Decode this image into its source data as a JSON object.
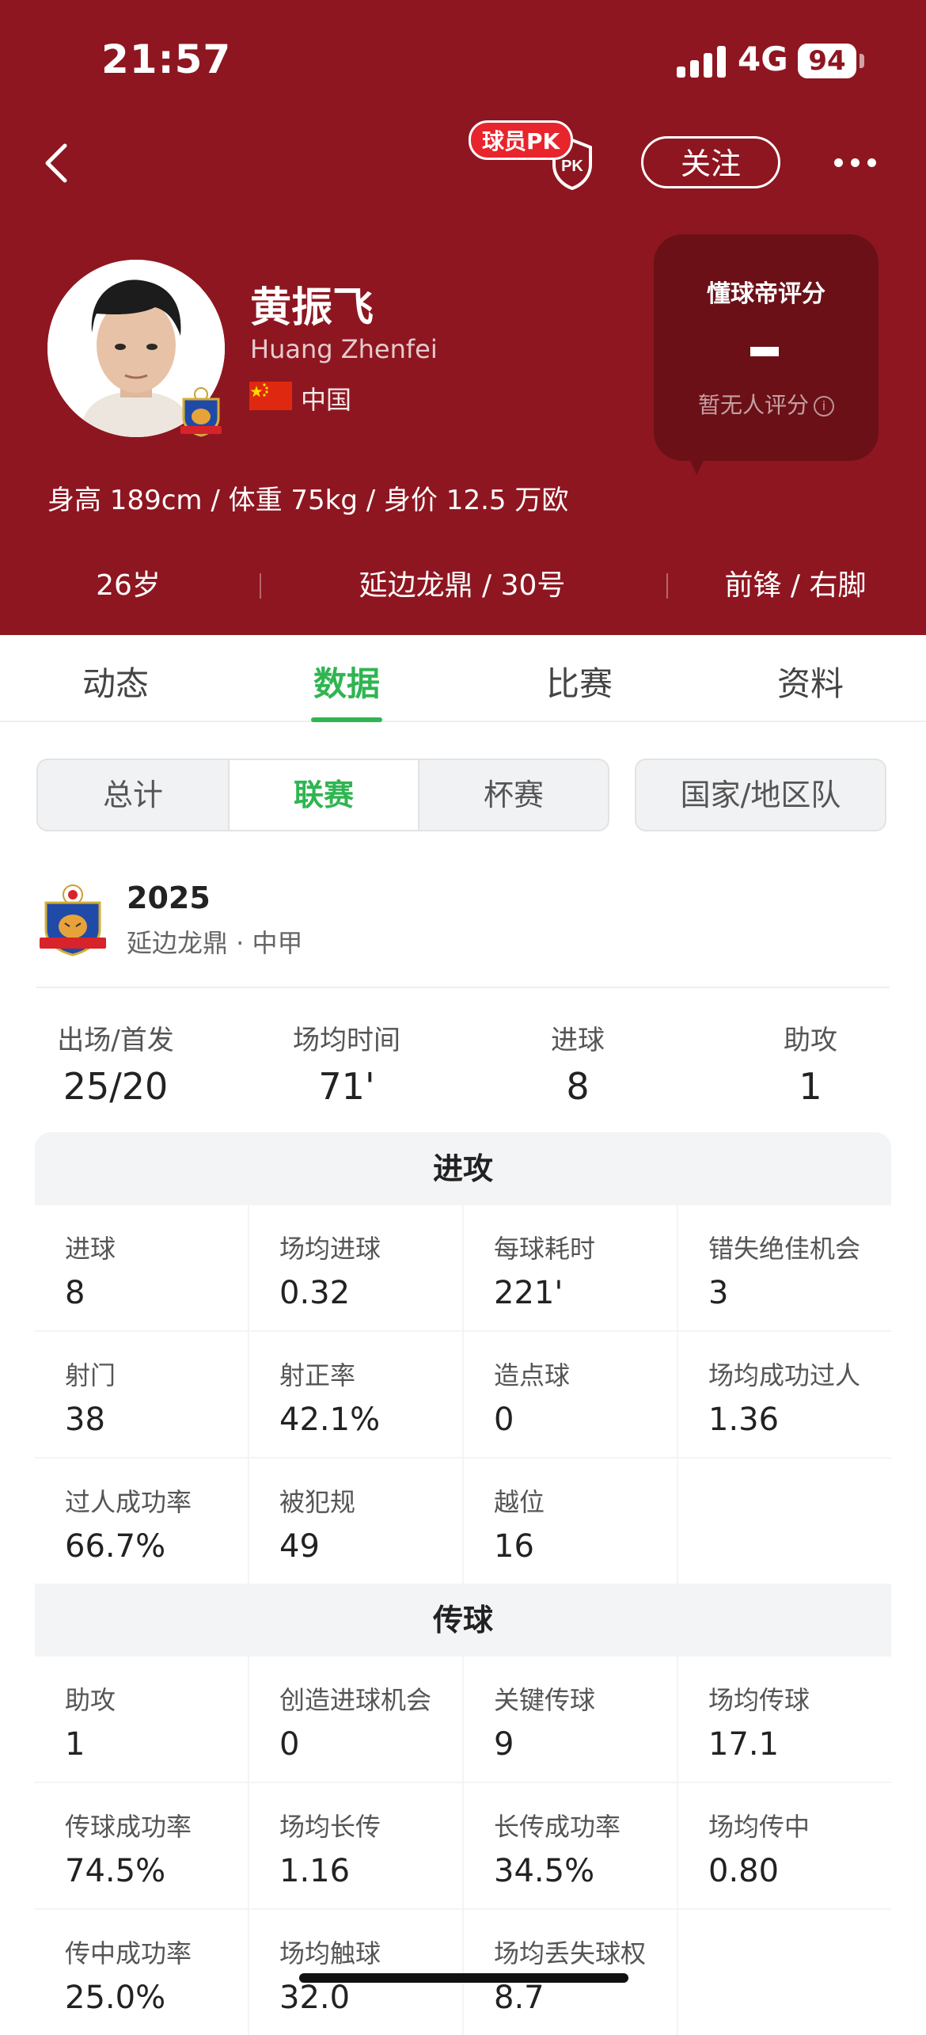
{
  "status_bar": {
    "time": "21:57",
    "network": "4G",
    "battery": "94"
  },
  "header": {
    "pk_label": "球员PK",
    "pk_shield_text": "PK",
    "follow_label": "关注",
    "player_name": "黄振飞",
    "player_name_en": "Huang Zhenfei",
    "country": "中国",
    "body_info": "身高 189cm / 体重 75kg / 身价 12.5 万欧",
    "rating": {
      "title": "懂球帝评分",
      "value": "-",
      "subtitle": "暂无人评分"
    },
    "meta": {
      "age": "26岁",
      "club_number": "延边龙鼎 / 30号",
      "position_foot": "前锋 / 右脚"
    },
    "colors": {
      "header_bg": "#8e1620",
      "rating_bg": "#6b1017",
      "accent_green": "#2fb551"
    }
  },
  "tabs": [
    {
      "label": "动态",
      "active": false
    },
    {
      "label": "数据",
      "active": true
    },
    {
      "label": "比赛",
      "active": false
    },
    {
      "label": "资料",
      "active": false
    }
  ],
  "segment": {
    "items": [
      {
        "label": "总计",
        "active": false
      },
      {
        "label": "联赛",
        "active": true
      },
      {
        "label": "杯赛",
        "active": false
      }
    ],
    "national_label": "国家/地区队"
  },
  "season": {
    "year": "2025",
    "league": "延边龙鼎 · 中甲",
    "summary": [
      {
        "label": "出场/首发",
        "value": "25/20"
      },
      {
        "label": "场均时间",
        "value": "71'"
      },
      {
        "label": "进球",
        "value": "8"
      },
      {
        "label": "助攻",
        "value": "1"
      }
    ]
  },
  "sections": [
    {
      "title": "进攻",
      "stats": [
        {
          "label": "进球",
          "value": "8"
        },
        {
          "label": "场均进球",
          "value": "0.32"
        },
        {
          "label": "每球耗时",
          "value": "221'"
        },
        {
          "label": "错失绝佳机会",
          "value": "3"
        },
        {
          "label": "射门",
          "value": "38"
        },
        {
          "label": "射正率",
          "value": "42.1%"
        },
        {
          "label": "造点球",
          "value": "0"
        },
        {
          "label": "场均成功过人",
          "value": "1.36"
        },
        {
          "label": "过人成功率",
          "value": "66.7%"
        },
        {
          "label": "被犯规",
          "value": "49"
        },
        {
          "label": "越位",
          "value": "16"
        },
        {
          "label": "",
          "value": ""
        }
      ]
    },
    {
      "title": "传球",
      "stats": [
        {
          "label": "助攻",
          "value": "1"
        },
        {
          "label": "创造进球机会",
          "value": "0"
        },
        {
          "label": "关键传球",
          "value": "9"
        },
        {
          "label": "场均传球",
          "value": "17.1"
        },
        {
          "label": "传球成功率",
          "value": "74.5%"
        },
        {
          "label": "场均长传",
          "value": "1.16"
        },
        {
          "label": "长传成功率",
          "value": "34.5%"
        },
        {
          "label": "场均传中",
          "value": "0.80"
        },
        {
          "label": "传中成功率",
          "value": "25.0%"
        },
        {
          "label": "场均触球",
          "value": "32.0"
        },
        {
          "label": "场均丢失球权",
          "value": "8.7"
        },
        {
          "label": "",
          "value": ""
        }
      ]
    }
  ]
}
